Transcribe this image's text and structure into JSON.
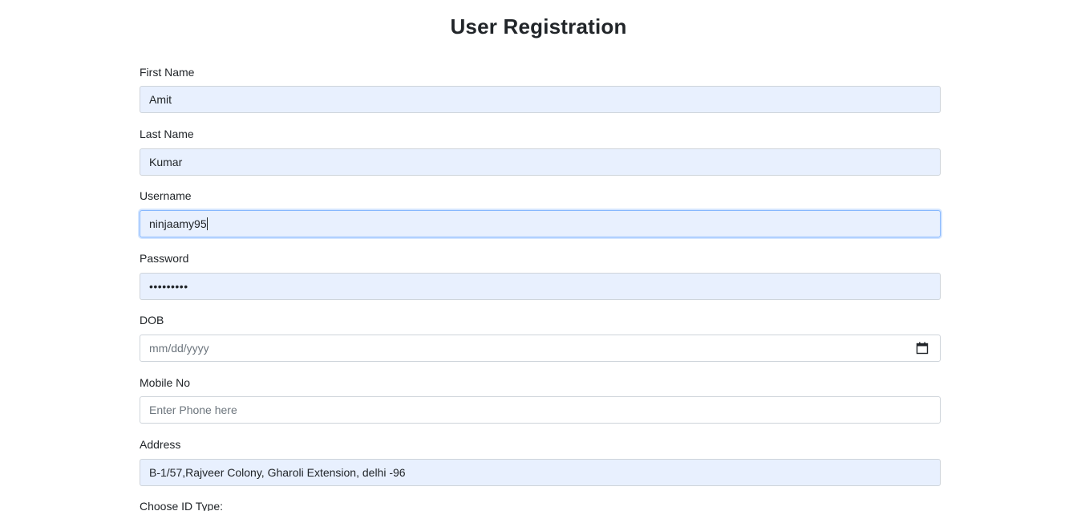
{
  "page": {
    "title": "User Registration"
  },
  "form": {
    "first_name": {
      "label": "First Name",
      "value": "Amit"
    },
    "last_name": {
      "label": "Last Name",
      "value": "Kumar"
    },
    "username": {
      "label": "Username",
      "value": "ninjaamy95"
    },
    "password": {
      "label": "Password",
      "value": "•••••••••"
    },
    "dob": {
      "label": "DOB",
      "placeholder": "mm/dd/yyyy",
      "icon": "calendar-icon"
    },
    "mobile": {
      "label": "Mobile No",
      "placeholder": "Enter Phone here"
    },
    "address": {
      "label": "Address",
      "value": "B-1/57,Rajveer Colony, Gharoli Extension, delhi -96"
    },
    "id_type": {
      "label": "Choose ID Type:"
    }
  },
  "colors": {
    "autofill_bg": "#e8f0fe",
    "focus_border": "#86b7fe",
    "border": "#ced4da",
    "text": "#212529",
    "placeholder": "#6c757d"
  }
}
